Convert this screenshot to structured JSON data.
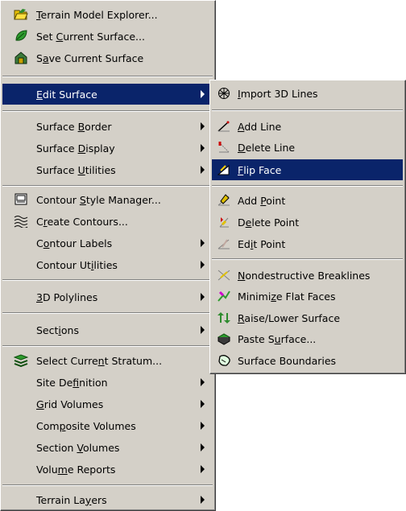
{
  "main_menu": {
    "terrain_model_explorer": {
      "pre": "",
      "acc": "T",
      "post": "errain Model Explorer...",
      "icon": "folder-open-icon"
    },
    "set_current_surface": {
      "pre": "Set ",
      "acc": "C",
      "post": "urrent Surface...",
      "icon": "green-leaf-icon"
    },
    "save_current_surface": {
      "pre": "S",
      "acc": "a",
      "post": "ve Current Surface",
      "icon": "house-save-icon"
    },
    "edit_surface": {
      "pre": "",
      "acc": "E",
      "post": "dit Surface"
    },
    "surface_border": {
      "pre": "Surface ",
      "acc": "B",
      "post": "order"
    },
    "surface_display": {
      "pre": "Surface ",
      "acc": "D",
      "post": "isplay"
    },
    "surface_utilities": {
      "pre": "Surface ",
      "acc": "U",
      "post": "tilities"
    },
    "contour_style_manager": {
      "pre": "Contour ",
      "acc": "S",
      "post": "tyle Manager...",
      "icon": "style-manager-icon"
    },
    "create_contours": {
      "pre": "C",
      "acc": "r",
      "post": "eate Contours...",
      "icon": "contours-icon"
    },
    "contour_labels": {
      "pre": "C",
      "acc": "o",
      "post": "ntour Labels"
    },
    "contour_utilities": {
      "pre": "Contour Ut",
      "acc": "i",
      "post": "lities"
    },
    "polylines_3d": {
      "pre": "",
      "acc": "3",
      "post": "D Polylines"
    },
    "sections": {
      "pre": "Sect",
      "acc": "i",
      "post": "ons"
    },
    "select_current_stratum": {
      "pre": "Select Curre",
      "acc": "n",
      "post": "t Stratum...",
      "icon": "stratum-icon"
    },
    "site_definition": {
      "pre": "Site De",
      "acc": "f",
      "post": "inition"
    },
    "grid_volumes": {
      "pre": "",
      "acc": "G",
      "post": "rid Volumes"
    },
    "composite_volumes": {
      "pre": "Com",
      "acc": "p",
      "post": "osite Volumes"
    },
    "section_volumes": {
      "pre": "Section ",
      "acc": "V",
      "post": "olumes"
    },
    "volume_reports": {
      "pre": "Volu",
      "acc": "m",
      "post": "e Reports"
    },
    "terrain_layers": {
      "pre": "Terrain La",
      "acc": "y",
      "post": "ers"
    }
  },
  "edit_surface_submenu": {
    "import_3d_lines": {
      "pre": "",
      "acc": "I",
      "post": "mport 3D Lines",
      "icon": "import-3d-lines-icon"
    },
    "add_line": {
      "pre": "",
      "acc": "A",
      "post": "dd Line",
      "icon": "add-line-icon"
    },
    "delete_line": {
      "pre": "",
      "acc": "D",
      "post": "elete Line",
      "icon": "delete-line-icon"
    },
    "flip_face": {
      "pre": "",
      "acc": "F",
      "post": "lip Face",
      "icon": "flip-face-icon"
    },
    "add_point": {
      "pre": "Add ",
      "acc": "P",
      "post": "oint",
      "icon": "add-point-icon"
    },
    "delete_point": {
      "pre": "D",
      "acc": "e",
      "post": "lete Point",
      "icon": "delete-point-icon"
    },
    "edit_point": {
      "pre": "Ed",
      "acc": "i",
      "post": "t Point",
      "icon": "edit-point-icon"
    },
    "nondestructive_breaklines": {
      "pre": "",
      "acc": "N",
      "post": "ondestructive Breaklines",
      "icon": "breaklines-icon"
    },
    "minimize_flat_faces": {
      "pre": "Minimi",
      "acc": "z",
      "post": "e Flat Faces",
      "icon": "minimize-flat-faces-icon"
    },
    "raise_lower_surface": {
      "pre": "",
      "acc": "R",
      "post": "aise/Lower Surface",
      "icon": "raise-lower-icon"
    },
    "paste_surface": {
      "pre": "Paste S",
      "acc": "u",
      "post": "rface...",
      "icon": "paste-surface-icon"
    },
    "surface_boundaries": {
      "pre": "Surface Boundaries",
      "acc": "",
      "post": "",
      "icon": "surface-boundaries-icon"
    }
  },
  "colors": {
    "menu_bg": "#d4d0c8",
    "highlight": "#0a246a",
    "highlight_text": "#ffffff"
  }
}
